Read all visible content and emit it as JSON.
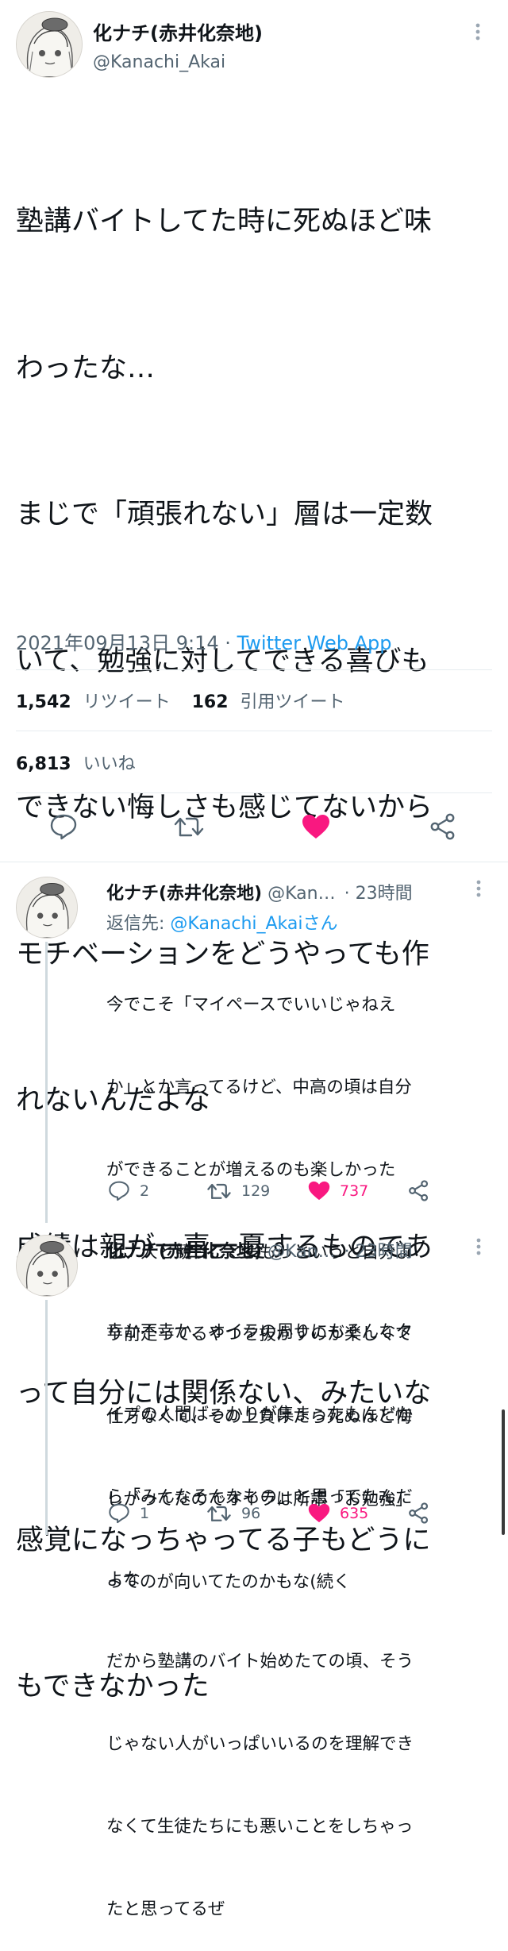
{
  "main_tweet": {
    "name": "化ナチ(赤井化奈地)",
    "handle": "@Kanachi_Akai",
    "lines": [
      "塾講バイトしてた時に死ぬほど味",
      "わったな…",
      "まじで「頑張れない」層は一定数",
      "いて、勉強に対してできる喜びも",
      "できない悔しさも感じてないから",
      "モチベーションをどうやっても作",
      "れないんだよな",
      "成績は親が一喜一憂するものであ",
      "って自分には関係ない、みたいな",
      "感覚になっちゃってる子もどうに",
      "もできなかった"
    ],
    "timestamp": "2021年09月13日 9:14 · ",
    "source": "Twitter Web App",
    "retweet_count": "1,542",
    "retweet_label": "リツイート",
    "quote_count": "162",
    "quote_label": "引用ツイート",
    "like_count": "6,813",
    "like_label": "いいね"
  },
  "replies": [
    {
      "name": "化ナチ(赤井化奈地)",
      "handle": "@Kan…",
      "time": "· 23時間",
      "reply_to_prefix": "返信先: ",
      "reply_to_handle": "@Kanachi_Akaiさん",
      "lines": [
        "今でこそ「マイペースでいいじゃねえ",
        "か」とか言ってるけど、中高の頃は自分",
        "ができることが増えるのも楽しかった",
        "し、人と競うこと、もっというと自分よ",
        "り前走ってるやつを抜かすのが楽しくて",
        "仕方なくて、その上負けたら死ぬほど悔",
        "しがってたのでオイラは所謂「お勉強」",
        "ってのが向いてたのかもな(続く"
      ],
      "replies": "2",
      "retweets": "129",
      "likes": "737"
    },
    {
      "name": "化ナチ(赤井化奈地)",
      "handle": "@Kan…",
      "time": "· 23時間",
      "lines": [
        "幸か不幸か、オイラの周りにもそんなタ",
        "イプの人間ばっかりが集まったもんだか",
        "ら「みんなそんなもの」と思ってたんだ",
        "よな",
        "だから塾講のバイト始めたての頃、そう",
        "じゃない人がいっぱいいるのを理解でき",
        "なくて生徒たちにも悪いことをしちゃっ",
        "たと思ってるぜ"
      ],
      "replies": "1",
      "retweets": "96",
      "likes": "635"
    }
  ],
  "colors": {
    "like": "#f91880",
    "link": "#1d9bf0",
    "muted": "#536471",
    "icon": "#536471"
  },
  "icons": [
    "more-icon",
    "reply-icon",
    "retweet-icon",
    "like-icon",
    "share-icon"
  ]
}
